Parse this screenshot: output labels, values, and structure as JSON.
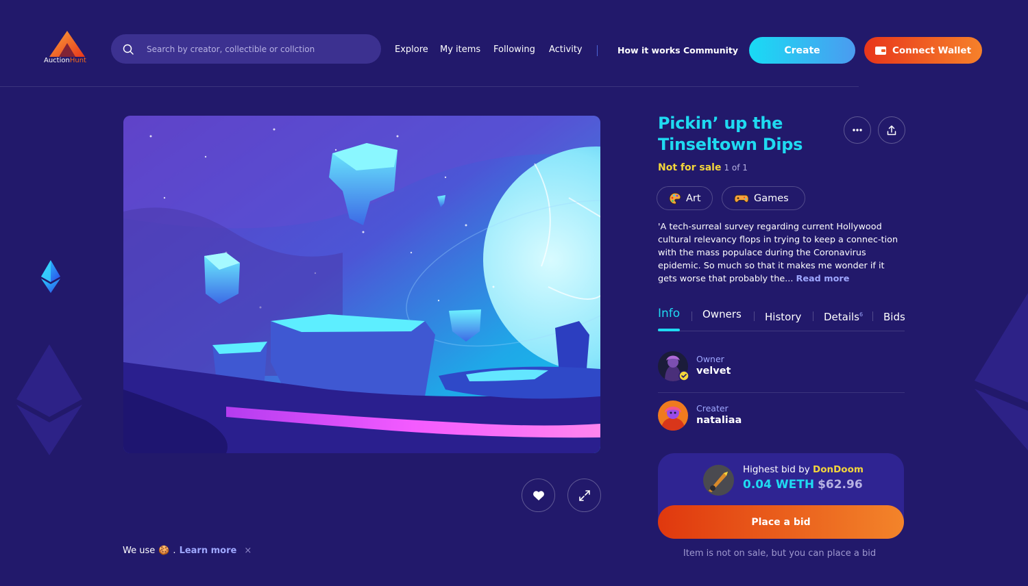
{
  "brand": {
    "name_part1": "Auction",
    "name_part2": "Hunt"
  },
  "search": {
    "placeholder": "Search by creator, collectible or collction"
  },
  "nav": {
    "explore": "Explore",
    "my_items": "My items",
    "following": "Following",
    "activity": "Activity",
    "how_it_works": "How it works",
    "community": "Community"
  },
  "header_actions": {
    "create": "Create",
    "connect_wallet": "Connect Wallet"
  },
  "item": {
    "title": "Pickin’ up the Tinseltown Dips",
    "status": "Not for sale",
    "edition": "1 of 1",
    "tags": [
      {
        "label": "Art",
        "icon": "palette-icon"
      },
      {
        "label": "Games",
        "icon": "gamepad-icon"
      }
    ],
    "description": "'A tech-surreal survey regarding current Hollywood cultural relevancy flops in trying to keep a connec-tion with the mass populace during the Coronavirus epidemic.  So much so that it makes me wonder if it gets worse that probably the...",
    "read_more": "Read more"
  },
  "tabs": {
    "info": "Info",
    "owners": "Owners",
    "history": "History",
    "details": "Details",
    "details_count": "6",
    "bids": "Bids"
  },
  "owner": {
    "role": "Owner",
    "name": "velvet"
  },
  "creator": {
    "role": "Creater",
    "name": "nataliaa"
  },
  "bid": {
    "label_prefix": "Highest bid by",
    "bidder": "DonDoom",
    "amount": "0.04 WETH",
    "usd": "$62.96",
    "button": "Place a bid",
    "note": "Item is not on sale, but you can place a bid"
  },
  "cookie": {
    "prefix": "We use",
    "suffix": ".",
    "learn_more": "Learn more",
    "close": "×"
  },
  "colors": {
    "background": "#22196b",
    "accent_cyan": "#1fdaf1",
    "accent_orange": "#f3842a",
    "accent_yellow": "#f4d63b",
    "link": "#9fa8ff"
  }
}
